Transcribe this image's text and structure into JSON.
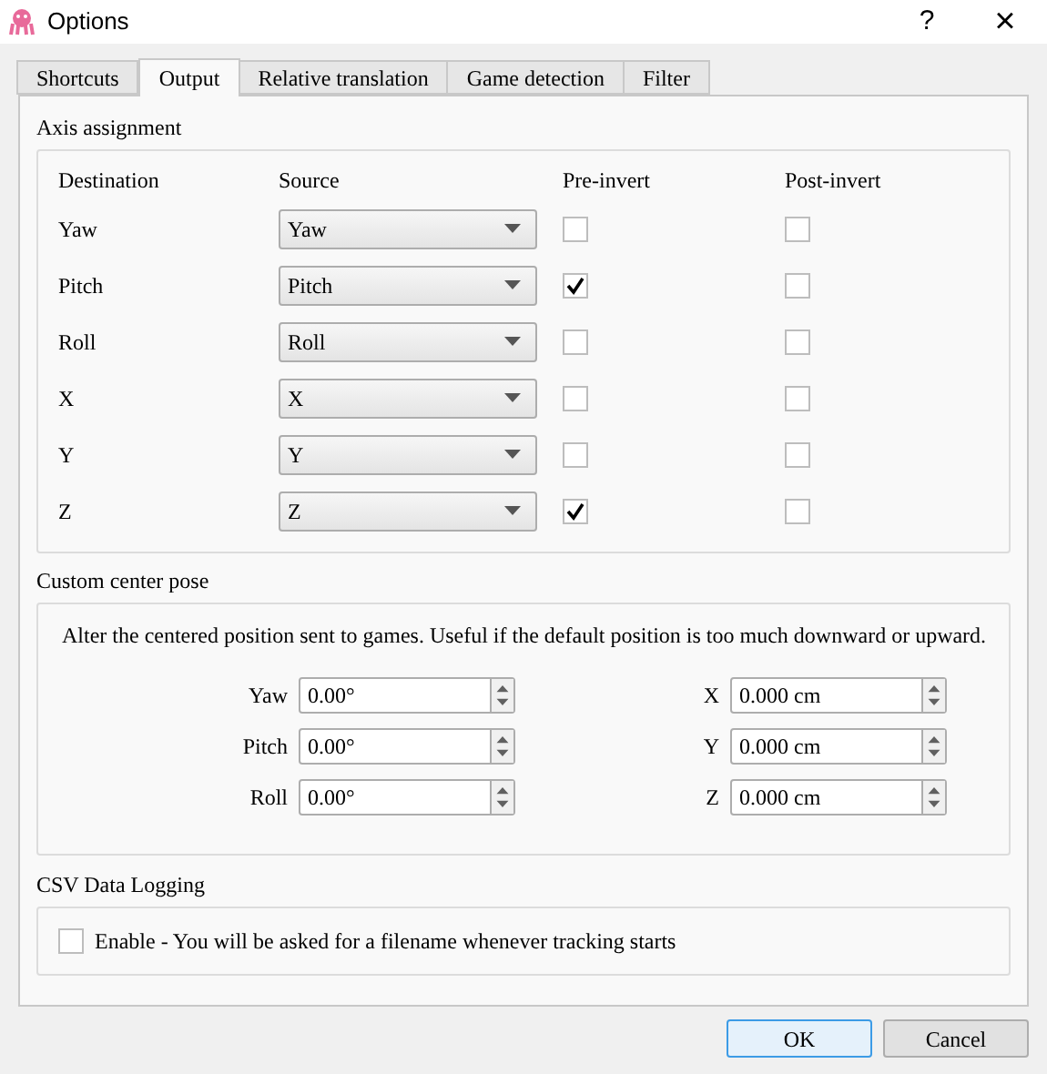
{
  "window": {
    "title": "Options",
    "help_glyph": "?",
    "close_glyph": "×"
  },
  "tabs": [
    {
      "label": "Shortcuts",
      "selected": false
    },
    {
      "label": "Output",
      "selected": true
    },
    {
      "label": "Relative translation",
      "selected": false
    },
    {
      "label": "Game detection",
      "selected": false
    },
    {
      "label": "Filter",
      "selected": false
    }
  ],
  "axis_assignment": {
    "title": "Axis assignment",
    "columns": [
      "Destination",
      "Source",
      "Pre-invert",
      "Post-invert"
    ],
    "rows": [
      {
        "destination": "Yaw",
        "source": "Yaw",
        "pre_invert": false,
        "post_invert": false
      },
      {
        "destination": "Pitch",
        "source": "Pitch",
        "pre_invert": true,
        "post_invert": false
      },
      {
        "destination": "Roll",
        "source": "Roll",
        "pre_invert": false,
        "post_invert": false
      },
      {
        "destination": "X",
        "source": "X",
        "pre_invert": false,
        "post_invert": false
      },
      {
        "destination": "Y",
        "source": "Y",
        "pre_invert": false,
        "post_invert": false
      },
      {
        "destination": "Z",
        "source": "Z",
        "pre_invert": true,
        "post_invert": false
      }
    ]
  },
  "custom_center_pose": {
    "title": "Custom center pose",
    "description": "Alter the centered position sent to games. Useful if the default position is too much downward or upward.",
    "rotation": [
      {
        "label": "Yaw",
        "value": "0.00°"
      },
      {
        "label": "Pitch",
        "value": "0.00°"
      },
      {
        "label": "Roll",
        "value": "0.00°"
      }
    ],
    "translation": [
      {
        "label": "X",
        "value": "0.000 cm"
      },
      {
        "label": "Y",
        "value": "0.000 cm"
      },
      {
        "label": "Z",
        "value": "0.000 cm"
      }
    ]
  },
  "csv_logging": {
    "title": "CSV Data Logging",
    "label": "Enable - You will be asked for a filename whenever tracking starts",
    "checked": false
  },
  "buttons": [
    {
      "label": "OK",
      "default": true
    },
    {
      "label": "Cancel",
      "default": false
    }
  ]
}
